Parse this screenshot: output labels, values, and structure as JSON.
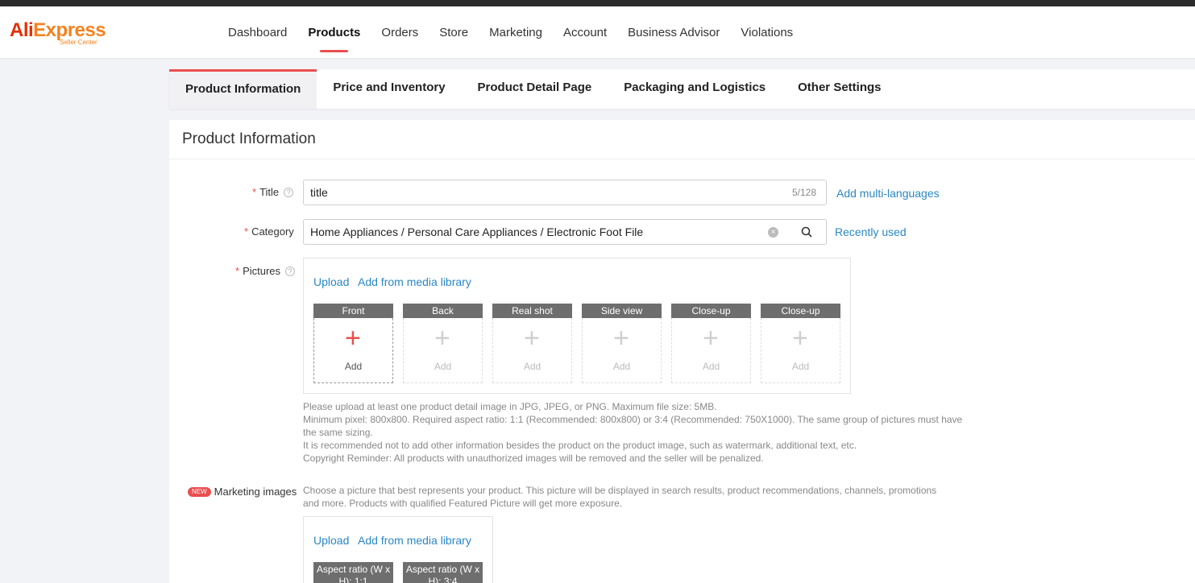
{
  "logo": {
    "main_ali": "Ali",
    "main_express": "Express",
    "sub": "Seller Center"
  },
  "nav": [
    {
      "label": "Dashboard"
    },
    {
      "label": "Products",
      "active": true
    },
    {
      "label": "Orders"
    },
    {
      "label": "Store"
    },
    {
      "label": "Marketing"
    },
    {
      "label": "Account"
    },
    {
      "label": "Business Advisor"
    },
    {
      "label": "Violations"
    }
  ],
  "tabs": [
    {
      "label": "Product Information",
      "active": true
    },
    {
      "label": "Price and Inventory"
    },
    {
      "label": "Product Detail Page"
    },
    {
      "label": "Packaging and Logistics"
    },
    {
      "label": "Other Settings"
    }
  ],
  "section_title": "Product Information",
  "title_field": {
    "label": "Title",
    "value": "title",
    "counter": "5/128",
    "link": "Add multi-languages"
  },
  "category_field": {
    "label": "Category",
    "value": "Home Appliances / Personal Care Appliances / Electronic Foot File",
    "link": "Recently used"
  },
  "pictures": {
    "label": "Pictures",
    "upload": "Upload",
    "media": "Add from media library",
    "add_label": "Add",
    "slots": [
      "Front",
      "Back",
      "Real shot",
      "Side view",
      "Close-up",
      "Close-up"
    ],
    "hints": [
      "Please upload at least one product detail image in JPG, JPEG, or PNG. Maximum file size: 5MB.",
      "Minimum pixel: 800x800. Required aspect ratio: 1:1 (Recommended: 800x800) or 3:4 (Recommended: 750X1000). The same group of pictures must have the same sizing.",
      "It is recommended not to add other information besides the product on the product image, such as watermark, additional text, etc.",
      "Copyright Reminder: All products with unauthorized images will be removed and the seller will be penalized."
    ]
  },
  "marketing": {
    "badge": "NEW",
    "label": "Marketing images",
    "hint": "Choose a picture that best represents your product. This picture will be displayed in search results, product recommendations, channels, promotions and more. Products with qualified Featured Picture will get more exposure.",
    "upload": "Upload",
    "media": "Add from media library",
    "slots": [
      "Aspect ratio (W x H): 1:1",
      "Aspect ratio (W x H): 3:4"
    ]
  }
}
